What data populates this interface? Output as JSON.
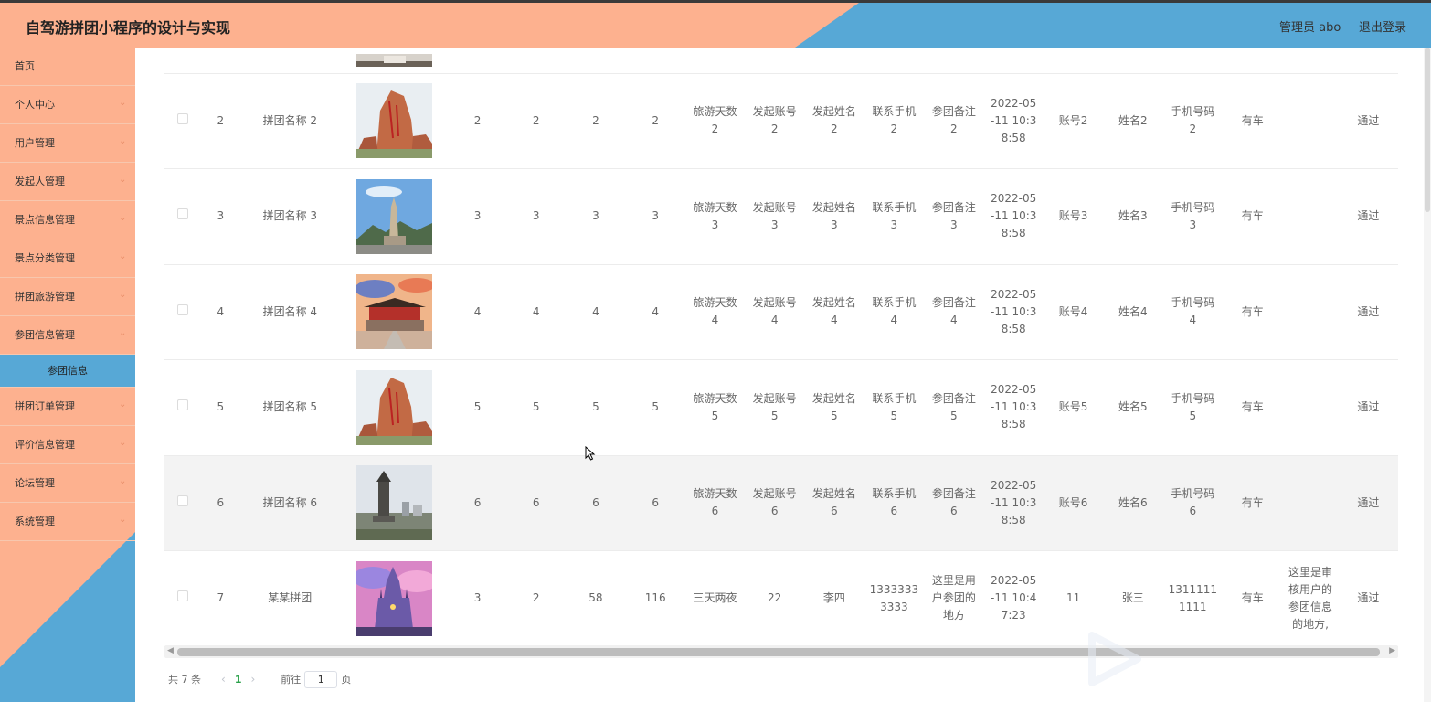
{
  "header": {
    "title": "自驾游拼团小程序的设计与实现",
    "user": "管理员 abo",
    "logout": "退出登录"
  },
  "sidebar": {
    "items": [
      {
        "label": "首页",
        "arrow": false
      },
      {
        "label": "个人中心",
        "arrow": true
      },
      {
        "label": "用户管理",
        "arrow": true
      },
      {
        "label": "发起人管理",
        "arrow": true
      },
      {
        "label": "景点信息管理",
        "arrow": true
      },
      {
        "label": "景点分类管理",
        "arrow": true
      },
      {
        "label": "拼团旅游管理",
        "arrow": true
      },
      {
        "label": "参团信息管理",
        "arrow": true
      }
    ],
    "sub_item": "参团信息",
    "items_after": [
      {
        "label": "拼团订单管理",
        "arrow": true
      },
      {
        "label": "评价信息管理",
        "arrow": true
      },
      {
        "label": "论坛管理",
        "arrow": true
      },
      {
        "label": "系统管理",
        "arrow": true
      }
    ]
  },
  "table": {
    "rows": [
      {
        "index": "2",
        "name": "拼团名称\n2",
        "img": "rock",
        "c1": "2",
        "c2": "2",
        "c3": "2",
        "c4": "2",
        "days": "旅游天数\n2",
        "acct": "发起账号\n2",
        "fname": "发起姓名\n2",
        "phone": "联系手机\n2",
        "note": "参团备注\n2",
        "time": "2022-05\n-11 10:3\n8:58",
        "uacct": "账号2",
        "uname": "姓名2",
        "uphone": "手机号码\n2",
        "car": "有车",
        "review": "",
        "status": "通过"
      },
      {
        "index": "3",
        "name": "拼团名称\n3",
        "img": "statue",
        "c1": "3",
        "c2": "3",
        "c3": "3",
        "c4": "3",
        "days": "旅游天数\n3",
        "acct": "发起账号\n3",
        "fname": "发起姓名\n3",
        "phone": "联系手机\n3",
        "note": "参团备注\n3",
        "time": "2022-05\n-11 10:3\n8:58",
        "uacct": "账号3",
        "uname": "姓名3",
        "uphone": "手机号码\n3",
        "car": "有车",
        "review": "",
        "status": "通过"
      },
      {
        "index": "4",
        "name": "拼团名称\n4",
        "img": "gate",
        "c1": "4",
        "c2": "4",
        "c3": "4",
        "c4": "4",
        "days": "旅游天数\n4",
        "acct": "发起账号\n4",
        "fname": "发起姓名\n4",
        "phone": "联系手机\n4",
        "note": "参团备注\n4",
        "time": "2022-05\n-11 10:3\n8:58",
        "uacct": "账号4",
        "uname": "姓名4",
        "uphone": "手机号码\n4",
        "car": "有车",
        "review": "",
        "status": "通过"
      },
      {
        "index": "5",
        "name": "拼团名称\n5",
        "img": "rock",
        "c1": "5",
        "c2": "5",
        "c3": "5",
        "c4": "5",
        "days": "旅游天数\n5",
        "acct": "发起账号\n5",
        "fname": "发起姓名\n5",
        "phone": "联系手机\n5",
        "note": "参团备注\n5",
        "time": "2022-05\n-11 10:3\n8:58",
        "uacct": "账号5",
        "uname": "姓名5",
        "uphone": "手机号码\n5",
        "car": "有车",
        "review": "",
        "status": "通过"
      },
      {
        "index": "6",
        "name": "拼团名称\n6",
        "img": "tower",
        "c1": "6",
        "c2": "6",
        "c3": "6",
        "c4": "6",
        "days": "旅游天数\n6",
        "acct": "发起账号\n6",
        "fname": "发起姓名\n6",
        "phone": "联系手机\n6",
        "note": "参团备注\n6",
        "time": "2022-05\n-11 10:3\n8:58",
        "uacct": "账号6",
        "uname": "姓名6",
        "uphone": "手机号码\n6",
        "car": "有车",
        "review": "",
        "status": "通过"
      },
      {
        "index": "7",
        "name": "某某拼团",
        "img": "castle",
        "c1": "3",
        "c2": "2",
        "c3": "58",
        "c4": "116",
        "days": "三天两夜",
        "acct": "22",
        "fname": "李四",
        "phone": "1333333\n3333",
        "note": "这里是用\n户参团的\n地方",
        "time": "2022-05\n-11 10:4\n7:23",
        "uacct": "11",
        "uname": "张三",
        "uphone": "1311111\n1111",
        "car": "有车",
        "review": "这里是审\n核用户的\n参团信息\n的地方,",
        "status": "通过"
      }
    ]
  },
  "pagination": {
    "total": "共 7 条",
    "current": "1",
    "goto_label": "前往",
    "goto_value": "1",
    "page_suffix": "页"
  },
  "colors": {
    "salmon": "#fdb18f",
    "blue": "#57a8d6",
    "active_page": "#2aa14a"
  }
}
